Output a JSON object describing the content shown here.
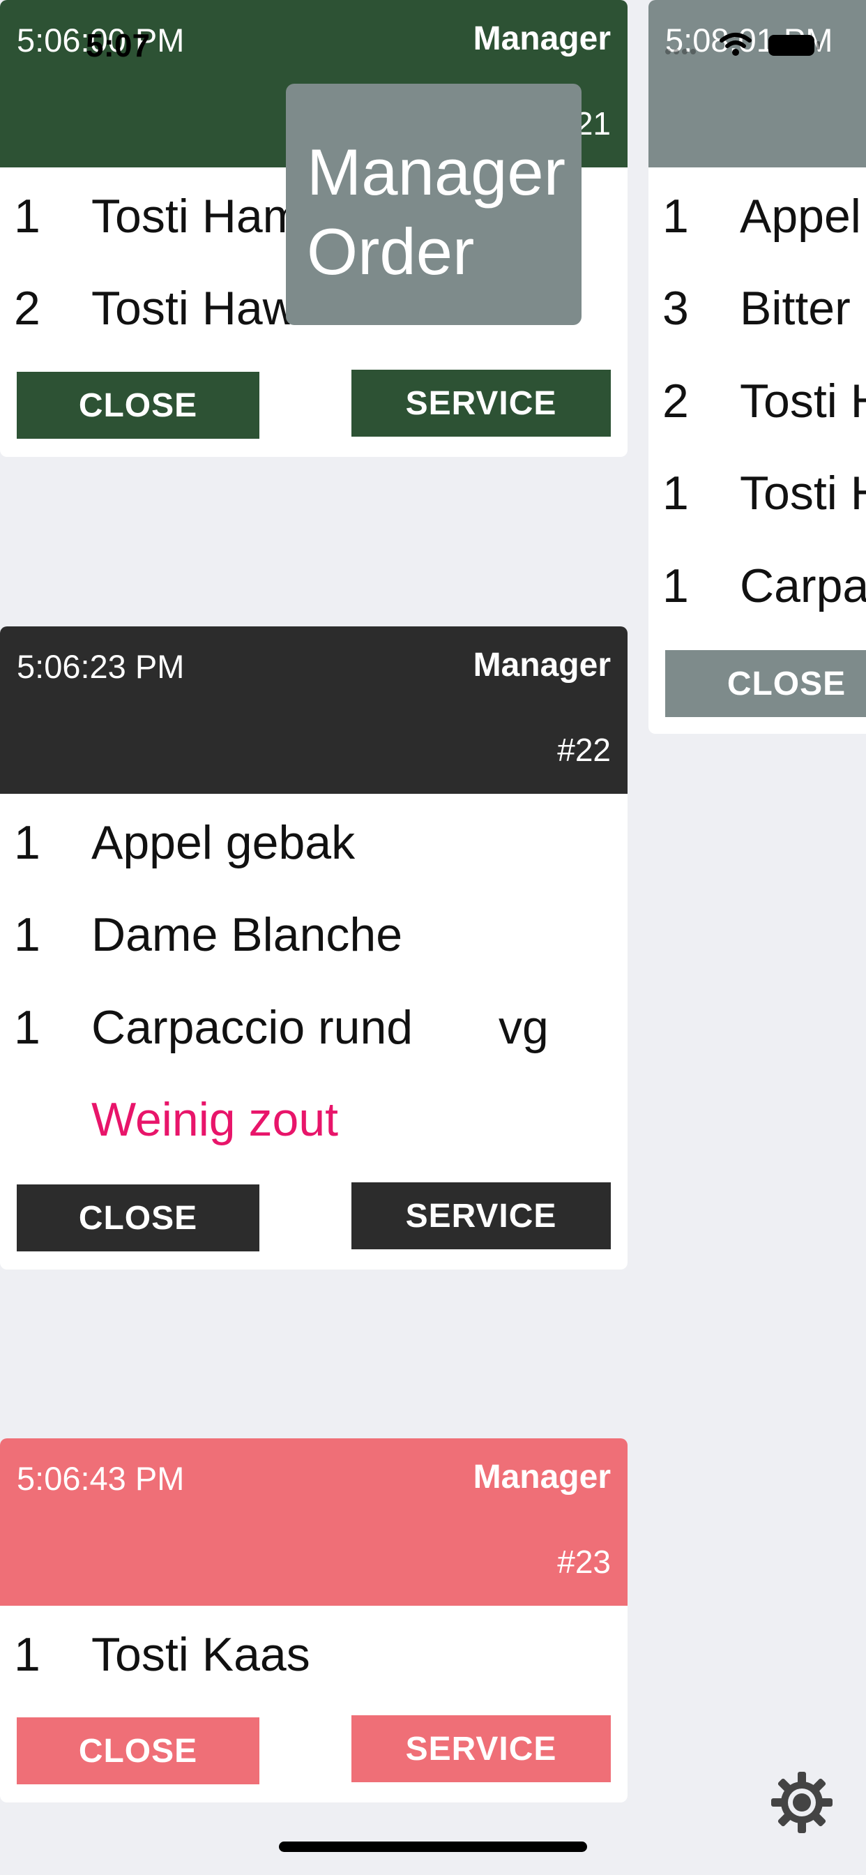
{
  "status_bar": {
    "time": "5:07"
  },
  "overlay": {
    "line1": "Manager",
    "line2": "Order"
  },
  "orders": [
    {
      "time": "5:06:00 PM",
      "role": "Manager",
      "number": "#21",
      "color": "#2d5234",
      "items": [
        {
          "qty": "1",
          "name": "Tosti Ham"
        },
        {
          "qty": "2",
          "name": "Tosti Haw"
        }
      ],
      "close_label": "CLOSE",
      "service_label": "SERVICE"
    },
    {
      "time": "5:06:23 PM",
      "role": "Manager",
      "number": "#22",
      "color": "#2c2c2c",
      "items": [
        {
          "qty": "1",
          "name": "Appel gebak"
        },
        {
          "qty": "1",
          "name": "Dame Blanche"
        },
        {
          "qty": "1",
          "name": "Carpaccio rund",
          "modifier": "vg"
        }
      ],
      "note": "Weinig zout",
      "close_label": "CLOSE",
      "service_label": "SERVICE"
    },
    {
      "time": "5:06:43 PM",
      "role": "Manager",
      "number": "#23",
      "color": "#ef6f77",
      "items": [
        {
          "qty": "1",
          "name": "Tosti Kaas"
        }
      ],
      "close_label": "CLOSE",
      "service_label": "SERVICE"
    },
    {
      "time": "5:08:01 PM",
      "color": "#7e8b8b",
      "items": [
        {
          "qty": "1",
          "name": "Appel"
        },
        {
          "qty": "3",
          "name": "Bitter"
        },
        {
          "qty": "2",
          "name": "Tosti H"
        },
        {
          "qty": "1",
          "name": "Tosti H"
        },
        {
          "qty": "1",
          "name": "Carpa"
        }
      ],
      "close_label": "CLOSE"
    }
  ],
  "icons": {
    "settings": "gear-icon",
    "wifi": "wifi-icon",
    "battery": "battery-icon"
  }
}
